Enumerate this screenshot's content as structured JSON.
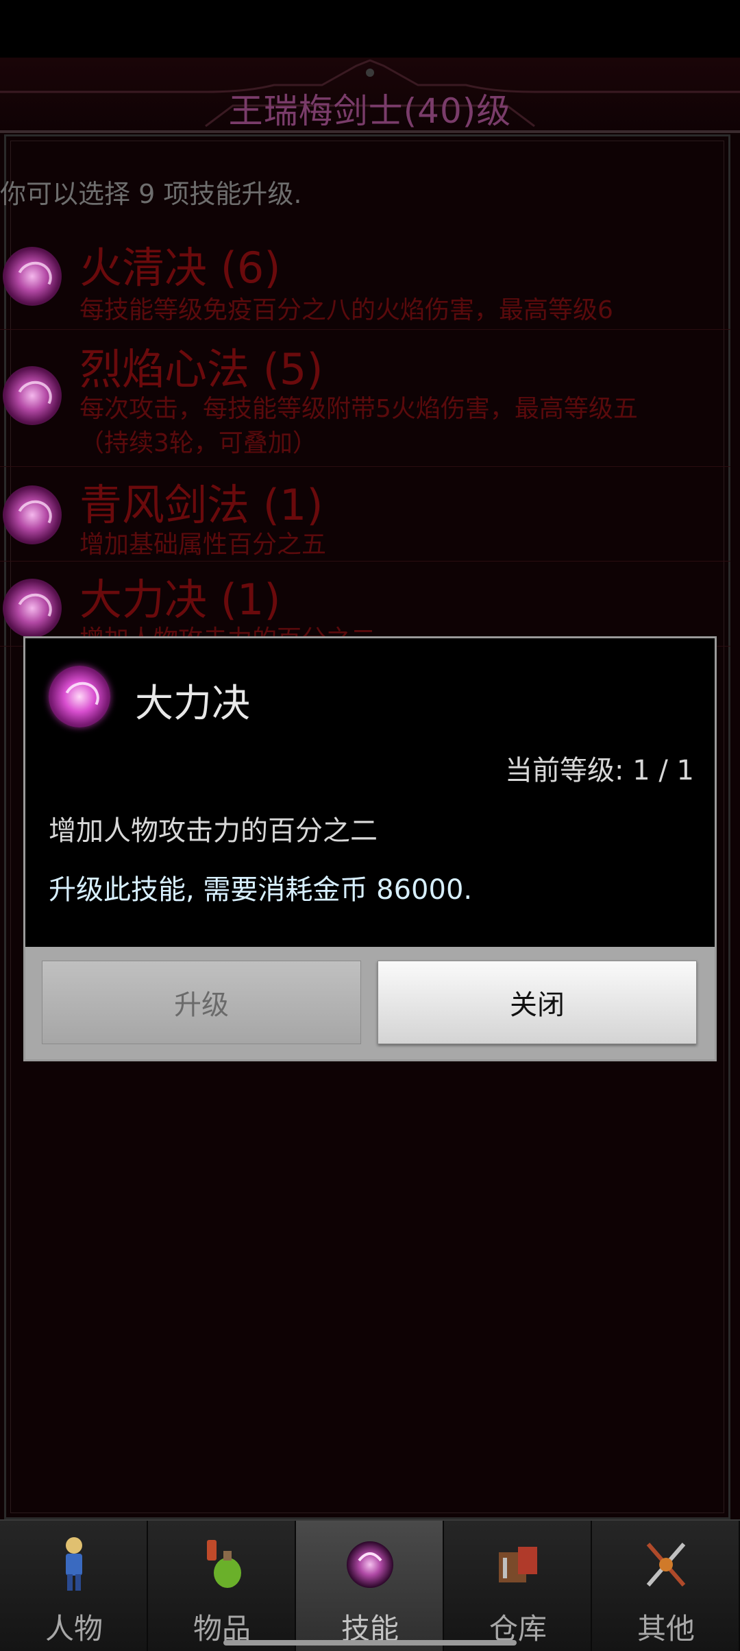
{
  "header": {
    "title": "王瑞梅剑士(40)级"
  },
  "select_note": "你可以选择  9  项技能升级.",
  "skills": [
    {
      "name": "火清决  (6)",
      "desc": "每技能等级免疫百分之八的火焰伤害，最高等级6"
    },
    {
      "name": "烈焰心法  (5)",
      "desc": "每次攻击，每技能等级附带5火焰伤害，最高等级五",
      "desc2": "（持续3轮，可叠加）"
    },
    {
      "name": "青风剑法  (1)",
      "desc": "增加基础属性百分之五"
    },
    {
      "name": "大力决  (1)",
      "desc": "增加人物攻击力的百分之二"
    }
  ],
  "dialog": {
    "title": "大力决",
    "icon": "skill-orb-icon",
    "level": "当前等级: 1  /  1",
    "desc": "增加人物攻击力的百分之二",
    "cost": "升级此技能, 需要消耗金币  86000.",
    "upgrade_label": "升级",
    "close_label": "关闭"
  },
  "nav": [
    {
      "label": "人物",
      "icon": "character-icon"
    },
    {
      "label": "物品",
      "icon": "potion-icon"
    },
    {
      "label": "技能",
      "icon": "skill-orb-icon",
      "active": true
    },
    {
      "label": "仓库",
      "icon": "warehouse-icon"
    },
    {
      "label": "其他",
      "icon": "crossed-weapons-icon"
    }
  ],
  "colors": {
    "background": "#0e0204",
    "skill_text": "#6a0a0c",
    "dialog_bg": "#000000"
  }
}
